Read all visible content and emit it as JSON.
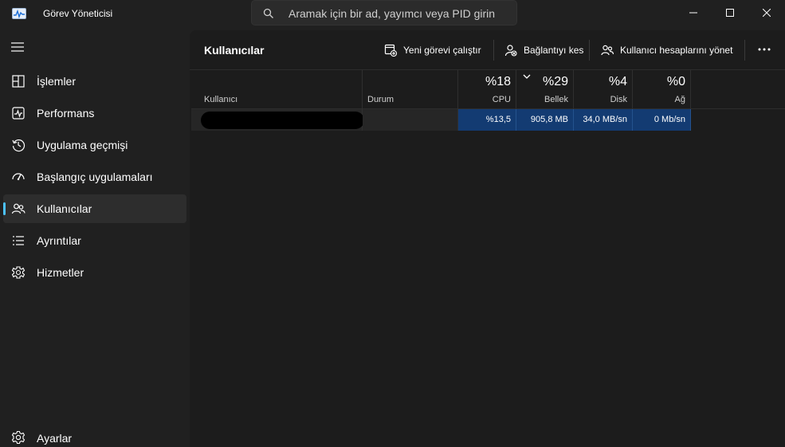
{
  "window": {
    "title": "Görev Yöneticisi",
    "search_placeholder": "Aramak için bir ad, yayımcı veya PID girin"
  },
  "sidebar": {
    "items": [
      {
        "label": "İşlemler",
        "icon": "processes-icon"
      },
      {
        "label": "Performans",
        "icon": "performance-icon"
      },
      {
        "label": "Uygulama geçmişi",
        "icon": "app-history-icon"
      },
      {
        "label": "Başlangıç uygulamaları",
        "icon": "startup-apps-icon"
      },
      {
        "label": "Kullanıcılar",
        "icon": "users-icon",
        "active": true
      },
      {
        "label": "Ayrıntılar",
        "icon": "details-icon"
      },
      {
        "label": "Hizmetler",
        "icon": "services-icon"
      }
    ],
    "settings_label": "Ayarlar"
  },
  "main": {
    "title": "Kullanıcılar",
    "toolbar": {
      "run_new_task": "Yeni görevi çalıştır",
      "disconnect": "Bağlantıyı kes",
      "manage_accounts": "Kullanıcı hesaplarını yönet"
    },
    "columns": {
      "user": "Kullanıcı",
      "status": "Durum",
      "cpu": {
        "percent": "%18",
        "label": "CPU"
      },
      "memory": {
        "percent": "%29",
        "label": "Bellek"
      },
      "disk": {
        "percent": "%4",
        "label": "Disk"
      },
      "network": {
        "percent": "%0",
        "label": "Ağ"
      }
    },
    "rows": [
      {
        "user": "",
        "status": "",
        "cpu": "%13,5",
        "memory": "905,8 MB",
        "disk": "34,0 MB/sn",
        "network": "0 Mb/sn"
      }
    ]
  },
  "colors": {
    "accent": "#4cc2ff",
    "highlight_cell": "#133b72",
    "background": "#202020",
    "panel": "#1c1c1c"
  }
}
